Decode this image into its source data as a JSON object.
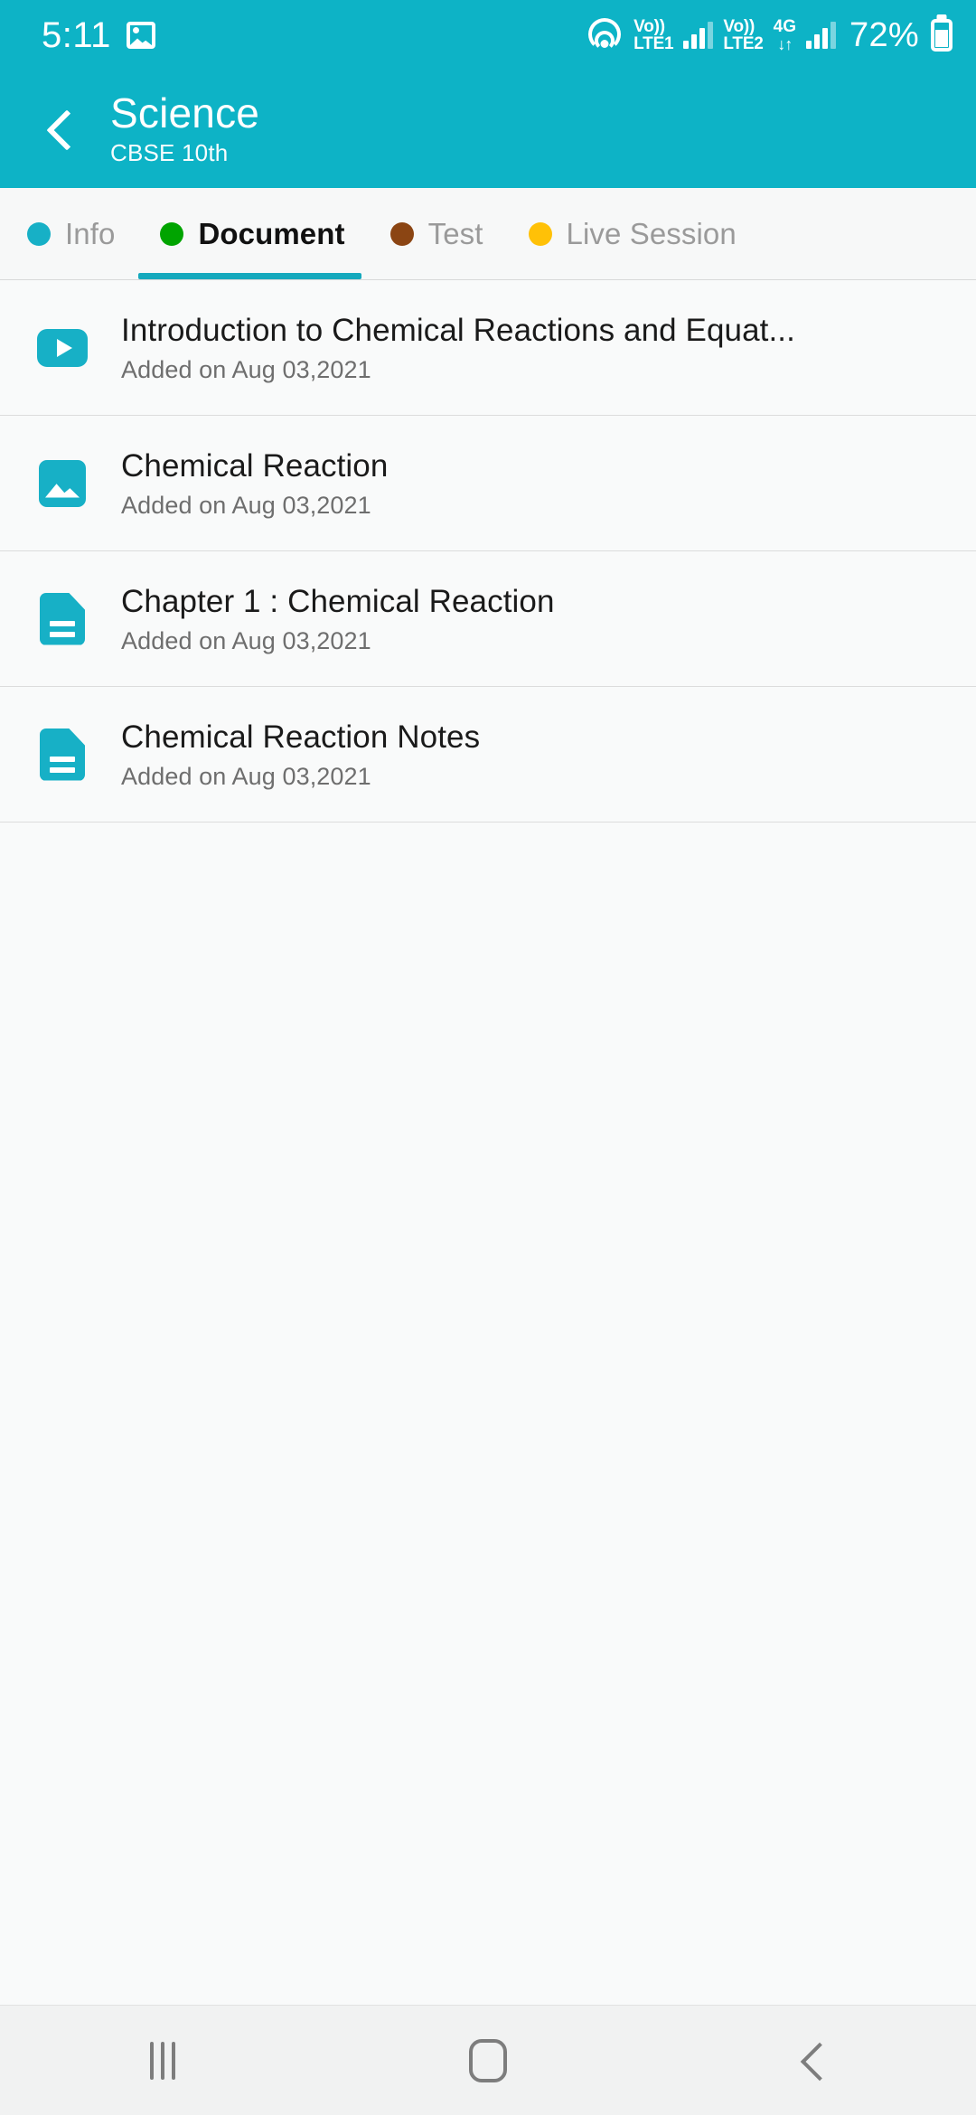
{
  "status_bar": {
    "time": "5:11",
    "gallery_icon": "gallery-icon",
    "hotspot_icon": "hotspot-icon",
    "sim1": {
      "volte_top": "Vo))",
      "volte_bottom": "LTE1"
    },
    "sim2": {
      "volte_top": "Vo))",
      "volte_bottom": "LTE2"
    },
    "network": {
      "generation": "4G",
      "data_arrows": "↓↑"
    },
    "battery_percent": "72%"
  },
  "header": {
    "back_icon": "back-chevron-icon",
    "title": "Science",
    "subtitle": "CBSE 10th",
    "background_color": "#0db3c6"
  },
  "tabs": {
    "active_index": 1,
    "items": [
      {
        "label": "Info",
        "dot_color": "#17b0c6",
        "active": false
      },
      {
        "label": "Document",
        "dot_color": "#00a400",
        "active": true
      },
      {
        "label": "Test",
        "dot_color": "#8b4513",
        "active": false
      },
      {
        "label": "Live Session",
        "dot_color": "#ffc107",
        "active": false
      }
    ],
    "indicator_color": "#15a9bd"
  },
  "document_list": {
    "items": [
      {
        "icon": "video-icon",
        "icon_type": "video",
        "title": "Introduction to Chemical Reactions and Equat...",
        "subtitle": "Added on Aug 03,2021"
      },
      {
        "icon": "image-icon",
        "icon_type": "image",
        "title": "Chemical Reaction",
        "subtitle": "Added on Aug 03,2021"
      },
      {
        "icon": "document-icon",
        "icon_type": "document",
        "title": "Chapter 1 : Chemical Reaction",
        "subtitle": "Added on Aug 03,2021"
      },
      {
        "icon": "document-icon",
        "icon_type": "document",
        "title": "Chemical Reaction Notes",
        "subtitle": "Added on Aug 03,2021"
      }
    ]
  },
  "navigation_bar": {
    "recents_icon": "recents-icon",
    "home_icon": "home-icon",
    "back_icon": "back-icon"
  }
}
